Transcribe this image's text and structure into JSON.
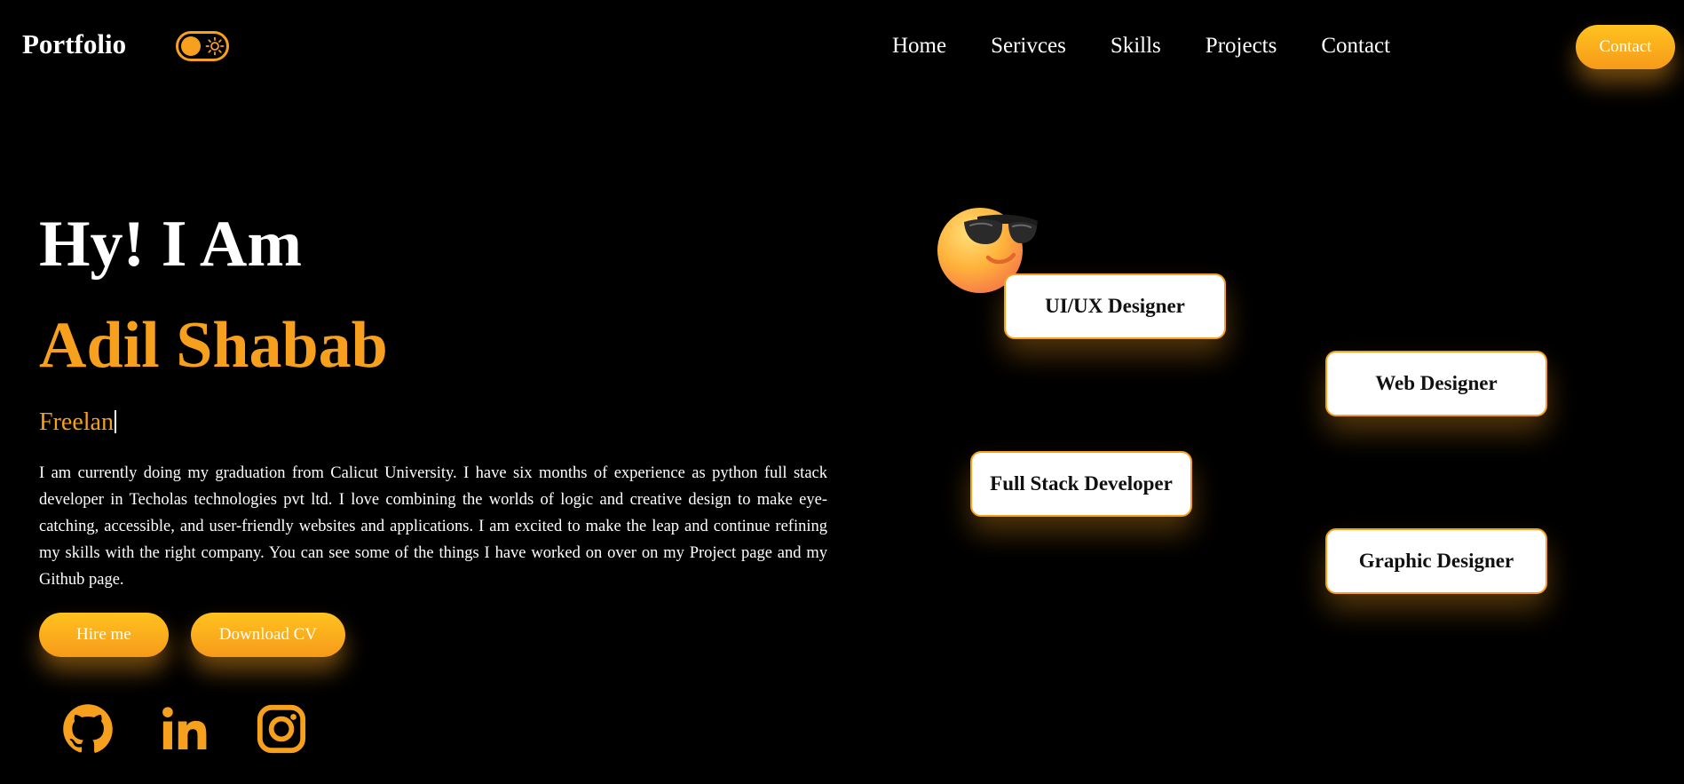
{
  "nav": {
    "logo": "Portfolio",
    "links": [
      "Home",
      "Serivces",
      "Skills",
      "Projects",
      "Contact"
    ],
    "contact_button": "Contact"
  },
  "hero": {
    "greeting": "Hy! I Am",
    "name": "Adil Shabab",
    "typing_text": "Freelan",
    "bio": "I am currently doing my graduation from Calicut University. I have six months of experience as python full stack developer in Techolas technologies pvt ltd. I love combining the worlds of logic and creative design to make eye-catching, accessible, and user-friendly websites and applications. I am excited to make the leap and continue refining my skills with the right company. You can see some of the things I have worked on over on my Project page and my Github page.",
    "hire_button": "Hire me",
    "cv_button": "Download CV"
  },
  "socials": [
    "github-icon",
    "linkedin-icon",
    "instagram-icon"
  ],
  "skills": [
    "UI/UX Designer",
    "Web Designer",
    "Full Stack Developer",
    "Graphic Designer"
  ],
  "colors": {
    "accent": "#f6a01e",
    "background": "#000000",
    "card": "#ffffff"
  }
}
